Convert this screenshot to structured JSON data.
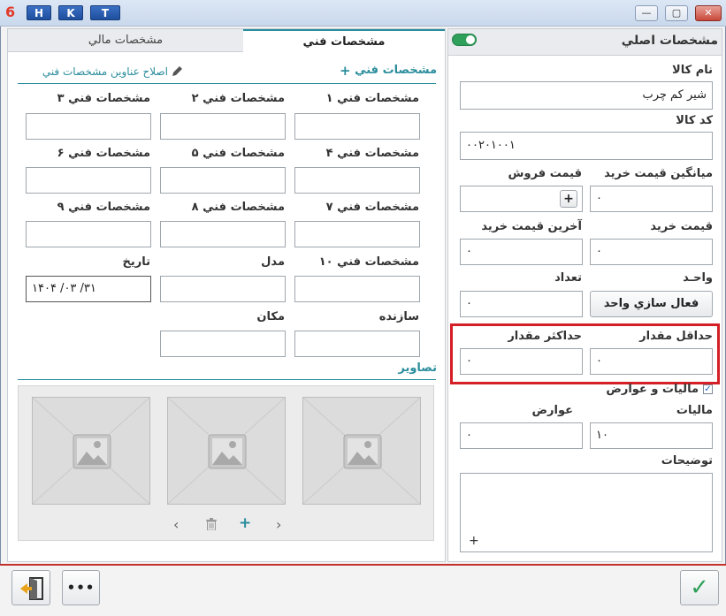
{
  "window": {
    "logo": "6",
    "hkt": [
      "H",
      "K",
      "T"
    ],
    "minimize": "—",
    "maximize": "▢",
    "close": "✕"
  },
  "left_tabs": {
    "financial": "مشخصات مالي",
    "technical": "مشخصات فني"
  },
  "technical": {
    "header": "مشخصات فني",
    "add_symbol": "+",
    "edit_titles": "اصلاح عناوين مشخصات فني",
    "fields": [
      {
        "label": "مشخصات فني ۱",
        "value": ""
      },
      {
        "label": "مشخصات فني ۲",
        "value": ""
      },
      {
        "label": "مشخصات فني ۳",
        "value": ""
      },
      {
        "label": "مشخصات فني ۴",
        "value": ""
      },
      {
        "label": "مشخصات فني ۵",
        "value": ""
      },
      {
        "label": "مشخصات فني ۶",
        "value": ""
      },
      {
        "label": "مشخصات فني ۷",
        "value": ""
      },
      {
        "label": "مشخصات فني ۸",
        "value": ""
      },
      {
        "label": "مشخصات فني ۹",
        "value": ""
      },
      {
        "label": "مشخصات فني ۱۰",
        "value": ""
      }
    ],
    "model_label": "مدل",
    "model_value": "",
    "date_label": "تاريخ",
    "date_value": "۱۴۰۴  /۰۳  /۳۱",
    "maker_label": "سازنده",
    "maker_value": "",
    "place_label": "مکان",
    "place_value": ""
  },
  "images": {
    "header": "تصاوير",
    "prev": "‹",
    "delete": "🗑",
    "add": "+",
    "next": "›",
    "thumb_icon": "image-placeholder-icon"
  },
  "main": {
    "header": "مشخصات اصلي",
    "toggle_on": true,
    "product_name_label": "نام کالا",
    "product_name_value": "شير کم چرب",
    "product_code_label": "کد کالا",
    "product_code_value": "۰۰۲۰۱۰۰۱",
    "avg_purchase_label": "ميانگين قيمت خريد",
    "avg_purchase_value": "۰",
    "sale_price_label": "قيمت فروش",
    "sale_price_value": "",
    "purchase_price_label": "قيمت خريد",
    "purchase_price_value": "۰",
    "last_purchase_label": "آخرين قيمت خريد",
    "last_purchase_value": "۰",
    "unit_label": "واحـد",
    "unit_button": "فعال سازي واحد",
    "count_label": "تعداد",
    "count_value": "۰",
    "min_qty_label": "حداقل مقدار",
    "min_qty_value": "۰",
    "max_qty_label": "حداکثر مقدار",
    "max_qty_value": "۰",
    "tax_checkbox_label": "ماليات و عوارض",
    "tax_checked": true,
    "tax_label": "ماليات",
    "tax_value": "۱۰",
    "duties_label": "عوارض",
    "duties_value": "۰",
    "description_label": "توضيحات",
    "description_value": "",
    "description_add": "+",
    "sale_plus": "+"
  },
  "footer": {
    "more": "•••",
    "confirm": "✓"
  },
  "colors": {
    "accent": "#2a8d9c",
    "highlight": "#d41f26",
    "confirm": "#2fa05a",
    "exit": "#e8a31a"
  }
}
